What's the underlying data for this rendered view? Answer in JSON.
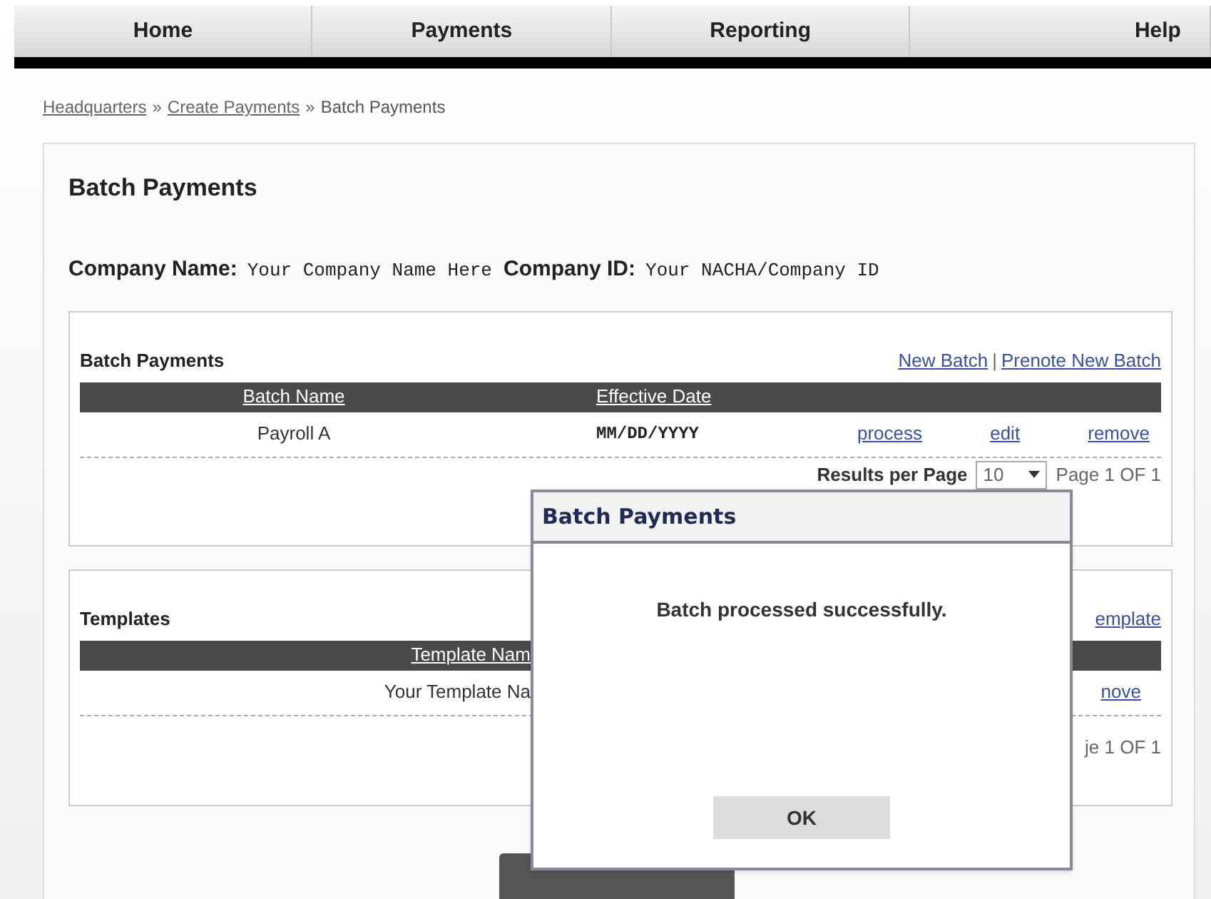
{
  "nav": {
    "tabs": [
      {
        "label": "Home"
      },
      {
        "label": "Payments"
      },
      {
        "label": "Reporting"
      },
      {
        "label": "Help"
      }
    ]
  },
  "breadcrumb": [
    {
      "kind": "link",
      "text": "Headquarters"
    },
    {
      "kind": "sep",
      "text": "»"
    },
    {
      "kind": "link",
      "text": "Create Payments"
    },
    {
      "kind": "sep",
      "text": "»"
    },
    {
      "kind": "current",
      "text": "Batch Payments"
    }
  ],
  "page": {
    "title": "Batch Payments",
    "company": [
      {
        "label": "Company Name:",
        "value": "Your Company Name Here"
      },
      {
        "label": "Company ID:",
        "value": "Your NACHA/Company ID"
      }
    ]
  },
  "batches": {
    "title": "Batch Payments",
    "links": [
      {
        "kind": "link",
        "text": "New Batch"
      },
      {
        "kind": "sep",
        "text": "|"
      },
      {
        "kind": "link",
        "text": "Prenote New Batch"
      }
    ],
    "columns": [
      "Batch Name",
      "Effective Date"
    ],
    "rows": [
      {
        "name": "Payroll A",
        "date": "MM/DD/YYYY",
        "actions": [
          "process",
          "edit",
          "remove"
        ]
      }
    ],
    "pager": {
      "label": "Results per Page",
      "per_page": "10",
      "page": "Page 1 OF 1"
    }
  },
  "templates": {
    "title": "Templates",
    "link": "emplate",
    "column": "Template Nam",
    "rows": [
      {
        "name": "Your Template Na",
        "action": "nove"
      }
    ],
    "page": "je 1 OF 1"
  },
  "dialog": {
    "title": "Batch Payments",
    "message": "Batch processed successfully.",
    "button": "OK"
  }
}
